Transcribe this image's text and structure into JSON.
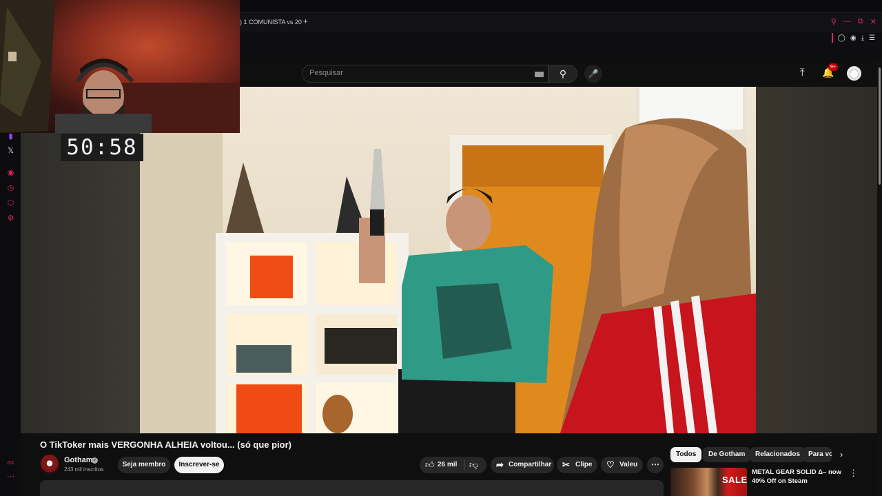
{
  "browser": {
    "tab_title": ") 1 COMUNISTA vs 20",
    "new_tab": "+",
    "window_controls": [
      "search",
      "minimize",
      "restore",
      "close"
    ],
    "accent_color": "#e0285a"
  },
  "sidebar": {
    "items": [
      "twitch-icon",
      "x-icon",
      "player-icon",
      "history-icon",
      "extensions-icon",
      "settings-icon"
    ],
    "bottom": [
      "gx-icon",
      "more-icon"
    ]
  },
  "header": {
    "search_placeholder": "Pesquisar",
    "notifications_badge": "9+"
  },
  "overlay": {
    "timer": "50:58"
  },
  "video": {
    "title": "O TikToker mais VERGONHA ALHEIA voltou... (só que pior)",
    "channel_name": "Gotham",
    "subscribers": "243 mil inscritos",
    "member_label": "Seja membro",
    "subscribe_label": "Inscrever-se",
    "likes": "26 mil",
    "share_label": "Compartilhar",
    "clip_label": "Clipe",
    "thanks_label": "Valeu"
  },
  "chips": [
    "Todos",
    "De Gotham",
    "Relacionados",
    "Para você"
  ],
  "recommendation": {
    "title": "METAL GEAR SOLID Δ– now 40% Off on Steam",
    "thumb_text": "SALE"
  }
}
